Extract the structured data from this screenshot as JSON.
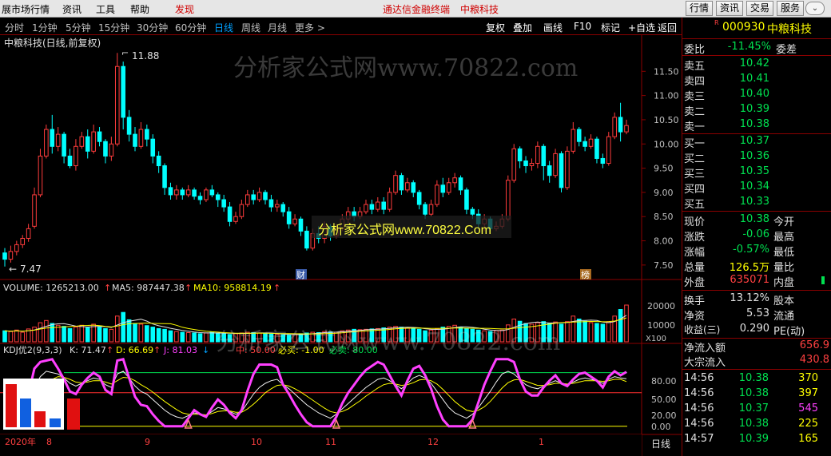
{
  "menu": {
    "items": [
      "展市场行情",
      "资讯",
      "工具",
      "帮助",
      "发现"
    ],
    "center_left": "通达信金融终端",
    "center_right": "中粮科技",
    "right_buttons": [
      "行情",
      "资讯",
      "交易",
      "服务"
    ],
    "win_icon": "chevron-down-icon"
  },
  "toolbar": {
    "periods": [
      "分时",
      "1分钟",
      "5分钟",
      "15分钟",
      "30分钟",
      "60分钟",
      "日线",
      "周线",
      "月线",
      "更多 >"
    ],
    "active_period": "日线",
    "tools": [
      "复权",
      "叠加",
      "画线",
      "F10",
      "标记",
      "+自选",
      "返回"
    ]
  },
  "chart": {
    "title": "中粮科技(日线,前复权)",
    "high_label": "11.88",
    "low_label": "7.47",
    "price_ticks": [
      "11.50",
      "11.00",
      "10.50",
      "10.00",
      "9.50",
      "9.00",
      "8.50",
      "8.00",
      "7.50"
    ],
    "marker_cai": "财",
    "marker_bang": "榜",
    "watermark_top": "分析家公式网www.70822.com",
    "watermark_mid": "分析家公式网www.70822.Com",
    "watermark_vol": "分析家公式网www.70822.com",
    "volume_header": {
      "volume": "VOLUME: 1265213.00",
      "ma5": "MA5: 987447.38",
      "ma10": "MA10: 958814.19"
    },
    "volume_ticks": [
      "20000",
      "10000"
    ],
    "volume_unit": "X100",
    "kdj_header": {
      "name": "KDJ优2(9,3,3)",
      "k": "K: 71.47",
      "d": "D: 66.69",
      "j": "J: 81.03",
      "zhong": "中: 50.00",
      "bimai": "必买: -1.00",
      "bimai2": "必卖: 80.00"
    },
    "kdj_ticks": [
      "80.00",
      "50.00",
      "20.00",
      "0.00"
    ],
    "date_labels": [
      "2020年",
      "8",
      "9",
      "10",
      "11",
      "12",
      "1"
    ],
    "period_label": "日线"
  },
  "quote": {
    "code": "000930",
    "name": "中粮科技",
    "weibi_label": "委比",
    "weibi_value": "-11.45%",
    "weicha_label": "委差",
    "asks": [
      {
        "label": "卖五",
        "price": "10.42"
      },
      {
        "label": "卖四",
        "price": "10.41"
      },
      {
        "label": "卖三",
        "price": "10.40"
      },
      {
        "label": "卖二",
        "price": "10.39"
      },
      {
        "label": "卖一",
        "price": "10.38"
      }
    ],
    "bids": [
      {
        "label": "买一",
        "price": "10.37"
      },
      {
        "label": "买二",
        "price": "10.36"
      },
      {
        "label": "买三",
        "price": "10.35"
      },
      {
        "label": "买四",
        "price": "10.34"
      },
      {
        "label": "买五",
        "price": "10.33"
      }
    ],
    "stats": [
      {
        "label": "现价",
        "value": "10.38",
        "right": "今开"
      },
      {
        "label": "涨跌",
        "value": "-0.06",
        "right": "最高"
      },
      {
        "label": "涨幅",
        "value": "-0.57%",
        "right": "最低"
      },
      {
        "label": "总量",
        "value": "126.5万",
        "right": "量比"
      },
      {
        "label": "外盘",
        "value": "635071",
        "right": "内盘"
      }
    ],
    "stats2": [
      {
        "label": "换手",
        "value": "13.12%",
        "right": "股本"
      },
      {
        "label": "净资",
        "value": "5.53",
        "right": "流通"
      },
      {
        "label": "收益(三)",
        "value": "0.290",
        "right": "PE(动)"
      }
    ],
    "flow": [
      {
        "label": "净流入额",
        "value": "656.9"
      },
      {
        "label": "大宗流入",
        "value": "430.8"
      }
    ],
    "ticks": [
      {
        "time": "14:56",
        "price": "10.38",
        "vol": "370"
      },
      {
        "time": "14:56",
        "price": "10.38",
        "vol": "397"
      },
      {
        "time": "14:56",
        "price": "10.37",
        "vol": "545"
      },
      {
        "time": "14:56",
        "price": "10.38",
        "vol": "225"
      },
      {
        "time": "14:57",
        "price": "10.39",
        "vol": "165"
      }
    ]
  },
  "chart_data": {
    "type": "candlestick",
    "ylim": [
      7.3,
      11.95
    ],
    "series": [
      {
        "o": 7.75,
        "c": 7.62,
        "h": 7.85,
        "l": 7.47
      },
      {
        "o": 7.62,
        "c": 7.78,
        "h": 7.9,
        "l": 7.55
      },
      {
        "o": 7.78,
        "c": 7.92,
        "h": 8.0,
        "l": 7.7
      },
      {
        "o": 7.92,
        "c": 8.05,
        "h": 8.12,
        "l": 7.85
      },
      {
        "o": 8.05,
        "c": 8.25,
        "h": 8.35,
        "l": 7.98
      },
      {
        "o": 8.3,
        "c": 8.95,
        "h": 9.1,
        "l": 8.25
      },
      {
        "o": 8.95,
        "c": 9.75,
        "h": 9.9,
        "l": 8.9
      },
      {
        "o": 9.75,
        "c": 10.3,
        "h": 10.4,
        "l": 9.7
      },
      {
        "o": 10.3,
        "c": 9.95,
        "h": 10.6,
        "l": 9.8
      },
      {
        "o": 9.95,
        "c": 10.2,
        "h": 10.35,
        "l": 9.85
      },
      {
        "o": 10.2,
        "c": 9.75,
        "h": 10.25,
        "l": 9.6
      },
      {
        "o": 9.75,
        "c": 9.55,
        "h": 9.9,
        "l": 9.5
      },
      {
        "o": 9.55,
        "c": 9.95,
        "h": 10.1,
        "l": 9.45
      },
      {
        "o": 9.95,
        "c": 10.15,
        "h": 10.25,
        "l": 9.9
      },
      {
        "o": 10.15,
        "c": 9.85,
        "h": 10.3,
        "l": 9.7
      },
      {
        "o": 9.85,
        "c": 10.25,
        "h": 10.4,
        "l": 9.8
      },
      {
        "o": 10.25,
        "c": 10.05,
        "h": 10.35,
        "l": 9.95
      },
      {
        "o": 10.05,
        "c": 9.75,
        "h": 10.1,
        "l": 9.6
      },
      {
        "o": 9.75,
        "c": 10.0,
        "h": 10.15,
        "l": 9.65
      },
      {
        "o": 10.0,
        "c": 11.6,
        "h": 11.88,
        "l": 9.95
      },
      {
        "o": 11.6,
        "c": 10.55,
        "h": 11.7,
        "l": 10.3
      },
      {
        "o": 10.55,
        "c": 10.2,
        "h": 10.7,
        "l": 10.05
      },
      {
        "o": 10.2,
        "c": 9.95,
        "h": 10.35,
        "l": 9.85
      },
      {
        "o": 9.95,
        "c": 10.3,
        "h": 10.45,
        "l": 9.9
      },
      {
        "o": 10.3,
        "c": 10.1,
        "h": 10.4,
        "l": 9.95
      },
      {
        "o": 10.1,
        "c": 9.75,
        "h": 10.2,
        "l": 9.6
      },
      {
        "o": 9.75,
        "c": 9.55,
        "h": 9.85,
        "l": 9.4
      },
      {
        "o": 9.55,
        "c": 9.1,
        "h": 9.6,
        "l": 8.95
      },
      {
        "o": 9.1,
        "c": 8.95,
        "h": 9.2,
        "l": 8.85
      },
      {
        "o": 8.95,
        "c": 9.05,
        "h": 9.15,
        "l": 8.85
      },
      {
        "o": 9.05,
        "c": 8.95,
        "h": 9.1,
        "l": 8.85
      },
      {
        "o": 8.95,
        "c": 9.05,
        "h": 9.15,
        "l": 8.9
      },
      {
        "o": 9.05,
        "c": 8.92,
        "h": 9.1,
        "l": 8.85
      },
      {
        "o": 8.92,
        "c": 8.85,
        "h": 9.0,
        "l": 8.75
      },
      {
        "o": 8.85,
        "c": 9.05,
        "h": 9.1,
        "l": 8.8
      },
      {
        "o": 9.05,
        "c": 8.95,
        "h": 9.15,
        "l": 8.9
      },
      {
        "o": 8.95,
        "c": 8.85,
        "h": 9.0,
        "l": 8.7
      },
      {
        "o": 8.85,
        "c": 8.7,
        "h": 8.95,
        "l": 8.6
      },
      {
        "o": 8.7,
        "c": 8.4,
        "h": 8.8,
        "l": 8.3
      },
      {
        "o": 8.4,
        "c": 8.5,
        "h": 8.6,
        "l": 8.35
      },
      {
        "o": 8.5,
        "c": 8.75,
        "h": 8.85,
        "l": 8.45
      },
      {
        "o": 8.75,
        "c": 8.95,
        "h": 9.05,
        "l": 8.7
      },
      {
        "o": 8.95,
        "c": 8.85,
        "h": 9.05,
        "l": 8.75
      },
      {
        "o": 8.85,
        "c": 9.0,
        "h": 9.1,
        "l": 8.8
      },
      {
        "o": 9.0,
        "c": 8.85,
        "h": 9.05,
        "l": 8.75
      },
      {
        "o": 8.85,
        "c": 8.7,
        "h": 8.95,
        "l": 8.6
      },
      {
        "o": 8.7,
        "c": 8.75,
        "h": 8.85,
        "l": 8.6
      },
      {
        "o": 8.75,
        "c": 8.6,
        "h": 8.8,
        "l": 8.5
      },
      {
        "o": 8.6,
        "c": 8.35,
        "h": 8.7,
        "l": 8.25
      },
      {
        "o": 8.35,
        "c": 8.45,
        "h": 8.55,
        "l": 8.3
      },
      {
        "o": 8.45,
        "c": 8.2,
        "h": 8.5,
        "l": 8.1
      },
      {
        "o": 8.2,
        "c": 7.85,
        "h": 8.3,
        "l": 7.8
      },
      {
        "o": 7.85,
        "c": 8.15,
        "h": 8.25,
        "l": 7.8
      },
      {
        "o": 8.15,
        "c": 8.05,
        "h": 8.3,
        "l": 7.95
      },
      {
        "o": 8.05,
        "c": 8.3,
        "h": 8.4,
        "l": 7.95
      },
      {
        "o": 8.3,
        "c": 8.1,
        "h": 8.35,
        "l": 8.0
      },
      {
        "o": 8.1,
        "c": 8.25,
        "h": 8.35,
        "l": 8.05
      },
      {
        "o": 8.25,
        "c": 8.45,
        "h": 8.55,
        "l": 8.2
      },
      {
        "o": 8.45,
        "c": 8.6,
        "h": 8.7,
        "l": 8.35
      },
      {
        "o": 8.6,
        "c": 8.5,
        "h": 8.7,
        "l": 8.4
      },
      {
        "o": 8.5,
        "c": 8.6,
        "h": 8.7,
        "l": 8.45
      },
      {
        "o": 8.6,
        "c": 8.75,
        "h": 8.85,
        "l": 8.55
      },
      {
        "o": 8.75,
        "c": 8.65,
        "h": 8.85,
        "l": 8.55
      },
      {
        "o": 8.65,
        "c": 8.8,
        "h": 8.9,
        "l": 8.6
      },
      {
        "o": 8.8,
        "c": 8.65,
        "h": 8.9,
        "l": 8.55
      },
      {
        "o": 8.65,
        "c": 9.0,
        "h": 9.1,
        "l": 8.6
      },
      {
        "o": 9.0,
        "c": 9.35,
        "h": 9.45,
        "l": 8.95
      },
      {
        "o": 9.35,
        "c": 9.05,
        "h": 9.4,
        "l": 8.95
      },
      {
        "o": 9.05,
        "c": 9.2,
        "h": 9.3,
        "l": 9.0
      },
      {
        "o": 9.2,
        "c": 9.0,
        "h": 9.25,
        "l": 8.9
      },
      {
        "o": 9.0,
        "c": 8.75,
        "h": 9.05,
        "l": 8.65
      },
      {
        "o": 8.75,
        "c": 8.55,
        "h": 8.8,
        "l": 8.45
      },
      {
        "o": 8.55,
        "c": 8.75,
        "h": 8.85,
        "l": 8.5
      },
      {
        "o": 8.75,
        "c": 9.15,
        "h": 9.25,
        "l": 8.7
      },
      {
        "o": 9.15,
        "c": 9.0,
        "h": 9.3,
        "l": 8.9
      },
      {
        "o": 9.0,
        "c": 9.2,
        "h": 9.3,
        "l": 8.95
      },
      {
        "o": 9.2,
        "c": 9.3,
        "h": 9.4,
        "l": 9.1
      },
      {
        "o": 9.3,
        "c": 9.05,
        "h": 9.35,
        "l": 8.95
      },
      {
        "o": 9.05,
        "c": 8.65,
        "h": 9.1,
        "l": 8.55
      },
      {
        "o": 8.65,
        "c": 8.55,
        "h": 8.7,
        "l": 8.45
      },
      {
        "o": 8.55,
        "c": 8.35,
        "h": 8.65,
        "l": 8.25
      },
      {
        "o": 8.35,
        "c": 8.45,
        "h": 8.55,
        "l": 8.2
      },
      {
        "o": 8.45,
        "c": 8.25,
        "h": 8.5,
        "l": 8.2
      },
      {
        "o": 8.25,
        "c": 8.3,
        "h": 8.4,
        "l": 8.2
      },
      {
        "o": 8.3,
        "c": 8.45,
        "h": 8.55,
        "l": 8.25
      },
      {
        "o": 8.45,
        "c": 9.25,
        "h": 9.35,
        "l": 8.4
      },
      {
        "o": 9.25,
        "c": 9.9,
        "h": 10.0,
        "l": 9.2
      },
      {
        "o": 9.9,
        "c": 9.65,
        "h": 9.95,
        "l": 9.5
      },
      {
        "o": 9.65,
        "c": 9.55,
        "h": 9.75,
        "l": 9.4
      },
      {
        "o": 9.55,
        "c": 9.6,
        "h": 9.7,
        "l": 9.45
      },
      {
        "o": 9.6,
        "c": 9.95,
        "h": 10.05,
        "l": 9.5
      },
      {
        "o": 9.95,
        "c": 9.55,
        "h": 10.0,
        "l": 9.25
      },
      {
        "o": 9.55,
        "c": 9.35,
        "h": 9.65,
        "l": 9.2
      },
      {
        "o": 9.35,
        "c": 9.8,
        "h": 9.9,
        "l": 9.3
      },
      {
        "o": 9.8,
        "c": 9.1,
        "h": 9.85,
        "l": 9.0
      },
      {
        "o": 9.1,
        "c": 9.85,
        "h": 9.95,
        "l": 9.05
      },
      {
        "o": 9.85,
        "c": 10.3,
        "h": 10.45,
        "l": 9.8
      },
      {
        "o": 10.3,
        "c": 10.05,
        "h": 10.35,
        "l": 9.95
      },
      {
        "o": 10.05,
        "c": 9.95,
        "h": 10.15,
        "l": 9.85
      },
      {
        "o": 9.95,
        "c": 10.1,
        "h": 10.2,
        "l": 9.9
      },
      {
        "o": 10.1,
        "c": 9.7,
        "h": 10.15,
        "l": 9.6
      },
      {
        "o": 9.7,
        "c": 9.6,
        "h": 9.8,
        "l": 9.5
      },
      {
        "o": 9.6,
        "c": 10.15,
        "h": 10.25,
        "l": 9.55
      },
      {
        "o": 10.15,
        "c": 10.55,
        "h": 10.65,
        "l": 10.1
      },
      {
        "o": 10.55,
        "c": 10.25,
        "h": 10.85,
        "l": 10.05
      },
      {
        "o": 10.25,
        "c": 10.38,
        "h": 10.5,
        "l": 10.2
      }
    ],
    "volume": [
      30,
      28,
      32,
      26,
      35,
      40,
      52,
      58,
      50,
      45,
      42,
      36,
      40,
      45,
      38,
      48,
      40,
      36,
      34,
      70,
      80,
      60,
      50,
      48,
      44,
      40,
      36,
      34,
      30,
      28,
      26,
      25,
      24,
      22,
      24,
      26,
      24,
      22,
      20,
      22,
      24,
      26,
      25,
      24,
      22,
      21,
      20,
      19,
      18,
      20,
      22,
      24,
      26,
      25,
      28,
      27,
      26,
      30,
      32,
      34,
      33,
      34,
      35,
      36,
      38,
      40,
      42,
      40,
      38,
      36,
      34,
      30,
      32,
      36,
      40,
      42,
      45,
      40,
      36,
      34,
      32,
      30,
      28,
      30,
      32,
      46,
      62,
      56,
      50,
      48,
      52,
      55,
      50,
      54,
      48,
      55,
      70,
      62,
      56,
      52,
      50,
      48,
      55,
      70,
      88,
      100
    ],
    "volume_ylim": [
      0,
      24000
    ],
    "kdj_k": [
      20,
      25,
      30,
      35,
      40,
      58,
      74,
      82,
      80,
      78,
      72,
      64,
      60,
      64,
      68,
      72,
      70,
      62,
      58,
      78,
      82,
      72,
      60,
      52,
      48,
      40,
      32,
      24,
      18,
      14,
      12,
      16,
      20,
      18,
      16,
      22,
      28,
      26,
      22,
      18,
      22,
      35,
      48,
      58,
      64,
      68,
      70,
      62,
      56,
      48,
      40,
      32,
      26,
      20,
      16,
      12,
      18,
      26,
      34,
      42,
      50,
      58,
      64,
      70,
      72,
      68,
      62,
      56,
      64,
      72,
      76,
      72,
      64,
      52,
      40,
      28,
      20,
      16,
      12,
      18,
      28,
      40,
      52,
      66,
      78,
      82,
      78,
      70,
      62,
      58,
      56,
      60,
      64,
      68,
      64,
      62,
      66,
      70,
      72,
      70,
      68,
      64,
      70,
      74,
      72,
      71
    ],
    "kdj_d": [
      30,
      30,
      30,
      32,
      36,
      44,
      54,
      64,
      70,
      74,
      73,
      70,
      66,
      65,
      66,
      68,
      68,
      66,
      63,
      68,
      73,
      72,
      68,
      62,
      57,
      51,
      44,
      37,
      31,
      25,
      20,
      18,
      18,
      18,
      17,
      19,
      22,
      23,
      23,
      21,
      21,
      26,
      33,
      41,
      50,
      56,
      61,
      62,
      60,
      56,
      51,
      45,
      39,
      33,
      27,
      22,
      20,
      22,
      26,
      32,
      38,
      45,
      51,
      57,
      62,
      64,
      63,
      61,
      62,
      65,
      69,
      70,
      68,
      63,
      55,
      46,
      37,
      30,
      24,
      22,
      24,
      29,
      37,
      47,
      57,
      65,
      69,
      70,
      67,
      64,
      61,
      61,
      62,
      64,
      64,
      63,
      64,
      66,
      68,
      68,
      68,
      67,
      68,
      70,
      70,
      66.69
    ],
    "kdj_j": [
      10,
      15,
      30,
      40,
      48,
      86,
      96,
      98,
      100,
      86,
      70,
      52,
      48,
      62,
      72,
      80,
      74,
      54,
      48,
      98,
      100,
      72,
      44,
      32,
      30,
      18,
      8,
      0,
      0,
      0,
      0,
      12,
      24,
      18,
      14,
      28,
      40,
      32,
      20,
      12,
      24,
      53,
      78,
      92,
      92,
      92,
      88,
      62,
      48,
      32,
      18,
      6,
      0,
      0,
      0,
      0,
      14,
      34,
      50,
      62,
      74,
      84,
      90,
      96,
      92,
      76,
      60,
      46,
      68,
      86,
      90,
      76,
      56,
      30,
      10,
      0,
      0,
      0,
      0,
      10,
      36,
      62,
      82,
      100,
      100,
      100,
      96,
      70,
      52,
      46,
      46,
      58,
      68,
      76,
      64,
      60,
      70,
      78,
      80,
      74,
      68,
      58,
      74,
      82,
      76,
      81.03
    ],
    "kdj_ylim": [
      -5,
      95
    ]
  }
}
